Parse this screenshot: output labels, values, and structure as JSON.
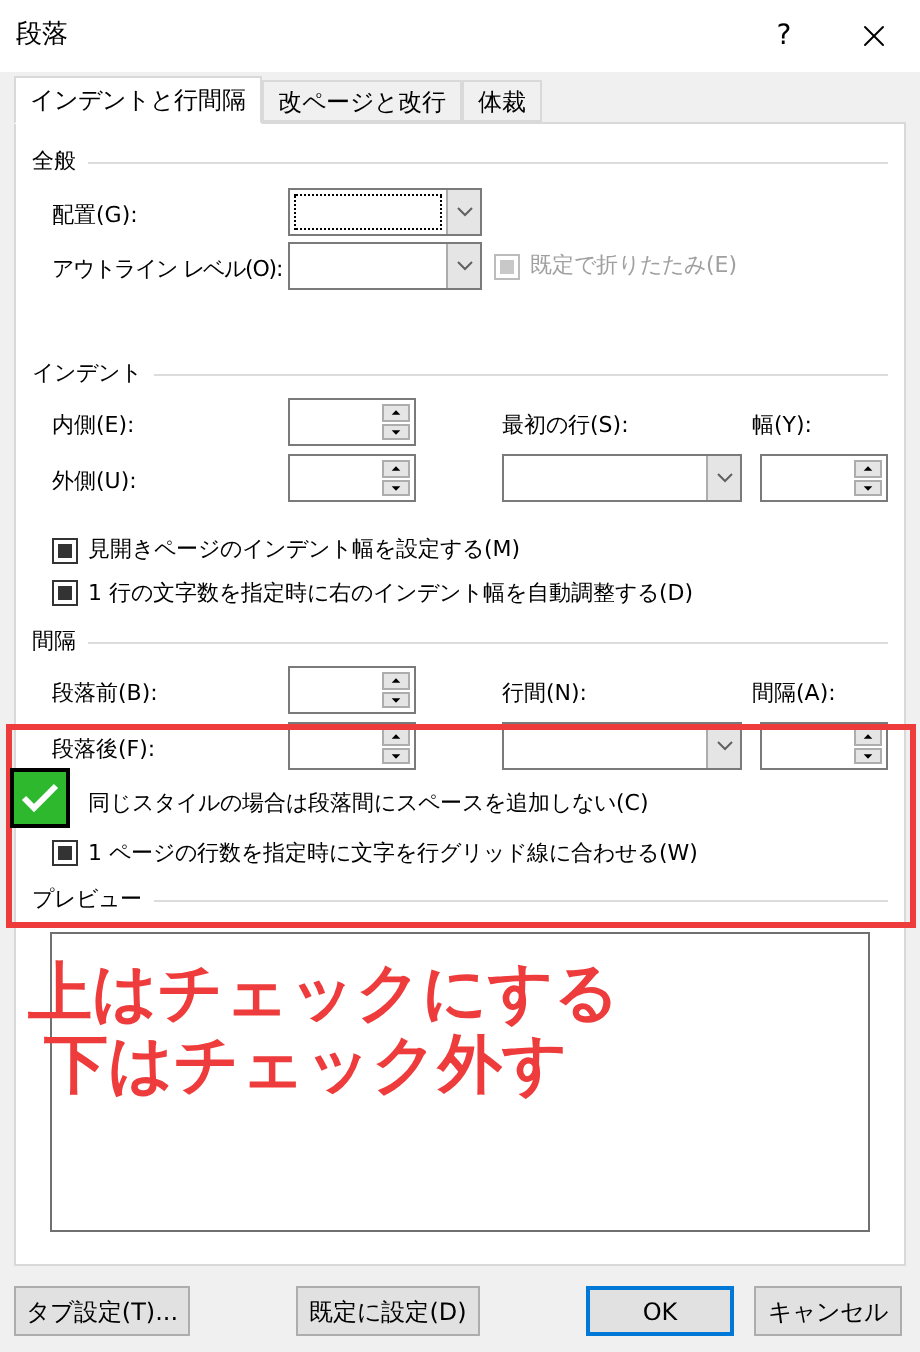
{
  "window": {
    "title": "段落",
    "help": "?"
  },
  "tabs": [
    {
      "label": "インデントと行間隔",
      "selected": true
    },
    {
      "label": "改ページと改行",
      "selected": false
    },
    {
      "label": "体裁",
      "selected": false
    }
  ],
  "general": {
    "title": "全般",
    "alignment": {
      "label": "配置(G):",
      "focused": true
    },
    "outline_level": {
      "label": "アウトライン レベル(O):",
      "focused": false
    },
    "collapse": {
      "label": "既定で折りたたみ(E)",
      "indeterminate": true,
      "disabled": true
    }
  },
  "indent": {
    "title": "インデント",
    "inside": {
      "label": "内側(E):"
    },
    "outside": {
      "label": "外側(U):"
    },
    "first_line": {
      "label": "最初の行(S):"
    },
    "by": {
      "label": "幅(Y):"
    },
    "checkboxes": [
      {
        "label": "見開きページのインデント幅を設定する(M)",
        "indeterminate": true
      },
      {
        "label": "1 行の文字数を指定時に右のインデント幅を自動調整する(D)",
        "indeterminate": true
      }
    ]
  },
  "spacing": {
    "title": "間隔",
    "before": {
      "label": "段落前(B):"
    },
    "after": {
      "label": "段落後(F):"
    },
    "line_spacing": {
      "label": "行間(N):"
    },
    "at": {
      "label": "間隔(A):"
    },
    "checkboxes": [
      {
        "label": "同じスタイルの場合は段落間にスペースを追加しない(C)"
      },
      {
        "label": "1 ページの行数を指定時に文字を行グリッド線に合わせる(W)",
        "indeterminate": true
      }
    ]
  },
  "preview": {
    "title": "プレビュー"
  },
  "buttons": [
    {
      "label": "タブ設定(T)...",
      "default": false
    },
    {
      "label": "既定に設定(D)",
      "default": false
    },
    {
      "label": "OK",
      "default": true
    },
    {
      "label": "キャンセル",
      "default": false
    }
  ],
  "annotation": {
    "lines": [
      "上はチェックにする",
      "下はチェック外す"
    ]
  }
}
